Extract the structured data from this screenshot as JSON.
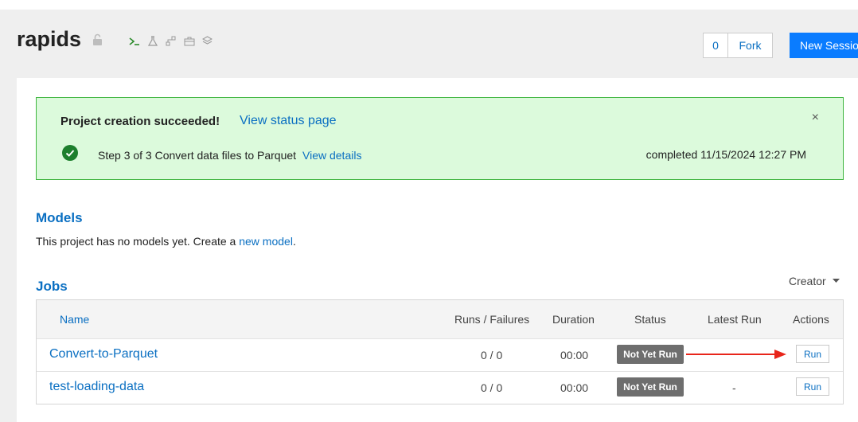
{
  "project": {
    "title": "rapids"
  },
  "header": {
    "fork_count": "0",
    "fork_label": "Fork",
    "new_session_label": "New Session",
    "icons": [
      "terminal-icon",
      "flask-icon",
      "flow-icon",
      "briefcase-icon",
      "layers-icon"
    ]
  },
  "alert": {
    "title": "Project creation succeeded!",
    "status_link": "View status page",
    "close": "×",
    "step_prefix": "Step 3 of 3",
    "step_text": "Convert data files to Parquet",
    "details_link": "View details",
    "completed": "completed 11/15/2024 12:27 PM",
    "accent": "#3fb53f"
  },
  "models": {
    "heading": "Models",
    "text_before": "This project has no models yet. Create a ",
    "link": "new model",
    "text_after": "."
  },
  "jobs": {
    "heading": "Jobs",
    "filter_label": "Creator",
    "columns": [
      "Name",
      "Runs / Failures",
      "Duration",
      "Status",
      "Latest Run",
      "Actions"
    ],
    "rows": [
      {
        "name": "Convert-to-Parquet",
        "runs": "0 / 0",
        "duration": "00:00",
        "status": "Not Yet Run",
        "latest": "",
        "action": "Run"
      },
      {
        "name": "test-loading-data",
        "runs": "0 / 0",
        "duration": "00:00",
        "status": "Not Yet Run",
        "latest": "-",
        "action": "Run"
      }
    ]
  },
  "colors": {
    "link": "#0a6fc2",
    "primary_button": "#0a7cff",
    "annotation_arrow": "#e8251a"
  }
}
